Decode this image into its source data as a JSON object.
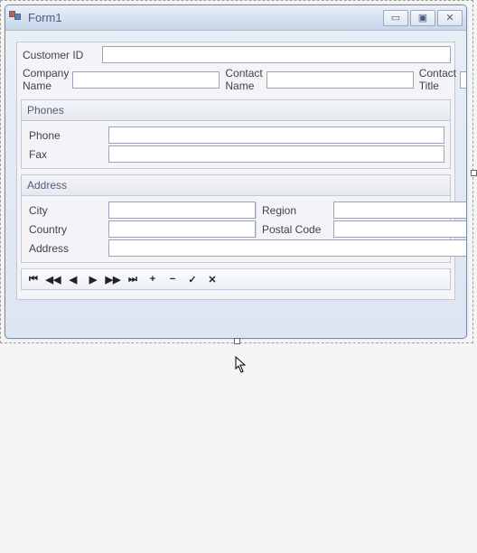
{
  "window": {
    "title": "Form1",
    "min_glyph": "▭",
    "max_glyph": "▣",
    "close_glyph": "✕"
  },
  "fields": {
    "customer_id": {
      "label": "Customer ID",
      "value": ""
    },
    "company_name": {
      "label": "Company Name",
      "value": ""
    },
    "contact_name": {
      "label": "Contact Name",
      "value": ""
    },
    "contact_title": {
      "label": "Contact Title",
      "value": ""
    }
  },
  "phones_group": {
    "title": "Phones",
    "phone": {
      "label": "Phone",
      "value": ""
    },
    "fax": {
      "label": "Fax",
      "value": ""
    }
  },
  "address_group": {
    "title": "Address",
    "city": {
      "label": "City",
      "value": ""
    },
    "region": {
      "label": "Region",
      "value": ""
    },
    "country": {
      "label": "Country",
      "value": ""
    },
    "postal_code": {
      "label": "Postal Code",
      "value": ""
    },
    "address": {
      "label": "Address",
      "value": ""
    }
  },
  "navigator": {
    "first": "⏮",
    "fast_back": "◀◀",
    "prev": "◀",
    "next": "▶",
    "fast_fwd": "▶▶",
    "last": "⏭",
    "add": "+",
    "delete": "−",
    "end_edit": "✓",
    "cancel": "✕"
  }
}
